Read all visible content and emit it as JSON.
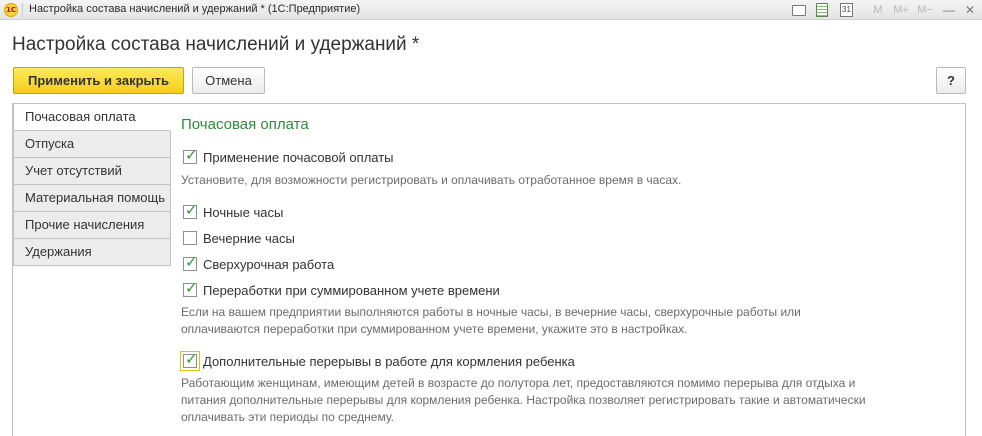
{
  "window": {
    "logo": "1С",
    "title": "Настройка состава начислений и удержаний *  (1С:Предприятие)",
    "toolbar_icons": [
      "print-icon",
      "calculator-icon",
      "calendar-icon"
    ],
    "calendar_day": "31",
    "memory_buttons": [
      "M",
      "M+",
      "M−"
    ],
    "minimize": "—",
    "close": "✕"
  },
  "form": {
    "title": "Настройка состава начислений и удержаний *",
    "apply_close": "Применить и закрыть",
    "cancel": "Отмена",
    "help": "?"
  },
  "tabs": [
    {
      "label": "Почасовая оплата",
      "active": true
    },
    {
      "label": "Отпуска",
      "active": false
    },
    {
      "label": "Учет отсутствий",
      "active": false
    },
    {
      "label": "Материальная помощь",
      "active": false
    },
    {
      "label": "Прочие начисления",
      "active": false
    },
    {
      "label": "Удержания",
      "active": false
    }
  ],
  "section": {
    "title": "Почасовая оплата",
    "options": [
      {
        "label": "Применение почасовой оплаты",
        "checked": true
      },
      {
        "label": "Ночные часы",
        "checked": true
      },
      {
        "label": "Вечерние часы",
        "checked": false
      },
      {
        "label": "Сверхурочная работа",
        "checked": true
      },
      {
        "label": "Переработки при суммированном учете времени",
        "checked": true
      },
      {
        "label": "Дополнительные перерывы в работе для кормления ребенка",
        "checked": true
      }
    ],
    "hints": [
      "Установите, для возможности регистрировать и оплачивать отработанное время в часах.",
      "Если на вашем предприятии выполняются работы в ночные часы, в вечерние часы, сверхурочные работы или оплачиваются переработки при суммированном учете времени, укажите это в настройках.",
      "Работающим женщинам, имеющим детей в возрасте до полутора лет, предоставляются помимо перерыва для отдыха и питания дополнительные перерывы для кормления ребенка. Настройка позволяет регистрировать такие и автоматически оплачивать эти периоды по среднему."
    ]
  },
  "colors": {
    "accent_yellow": "#f4cf1a",
    "section_green": "#2e8b3a",
    "check_green": "#2e9a36",
    "hint_gray": "#6b6b6b"
  }
}
